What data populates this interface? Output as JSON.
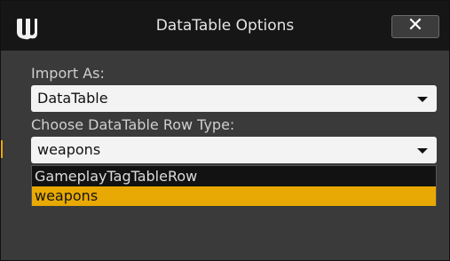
{
  "window": {
    "title": "DataTable Options",
    "close_label": "✕"
  },
  "import_as": {
    "label": "Import As:",
    "value": "DataTable"
  },
  "row_type": {
    "label": "Choose DataTable Row Type:",
    "value": "weapons",
    "options": [
      {
        "label": "GameplayTagTableRow",
        "selected": false
      },
      {
        "label": "weapons",
        "selected": true
      }
    ]
  },
  "colors": {
    "accent": "#e8a904",
    "titlebar": "#161616",
    "panel": "#3a3a3a"
  }
}
